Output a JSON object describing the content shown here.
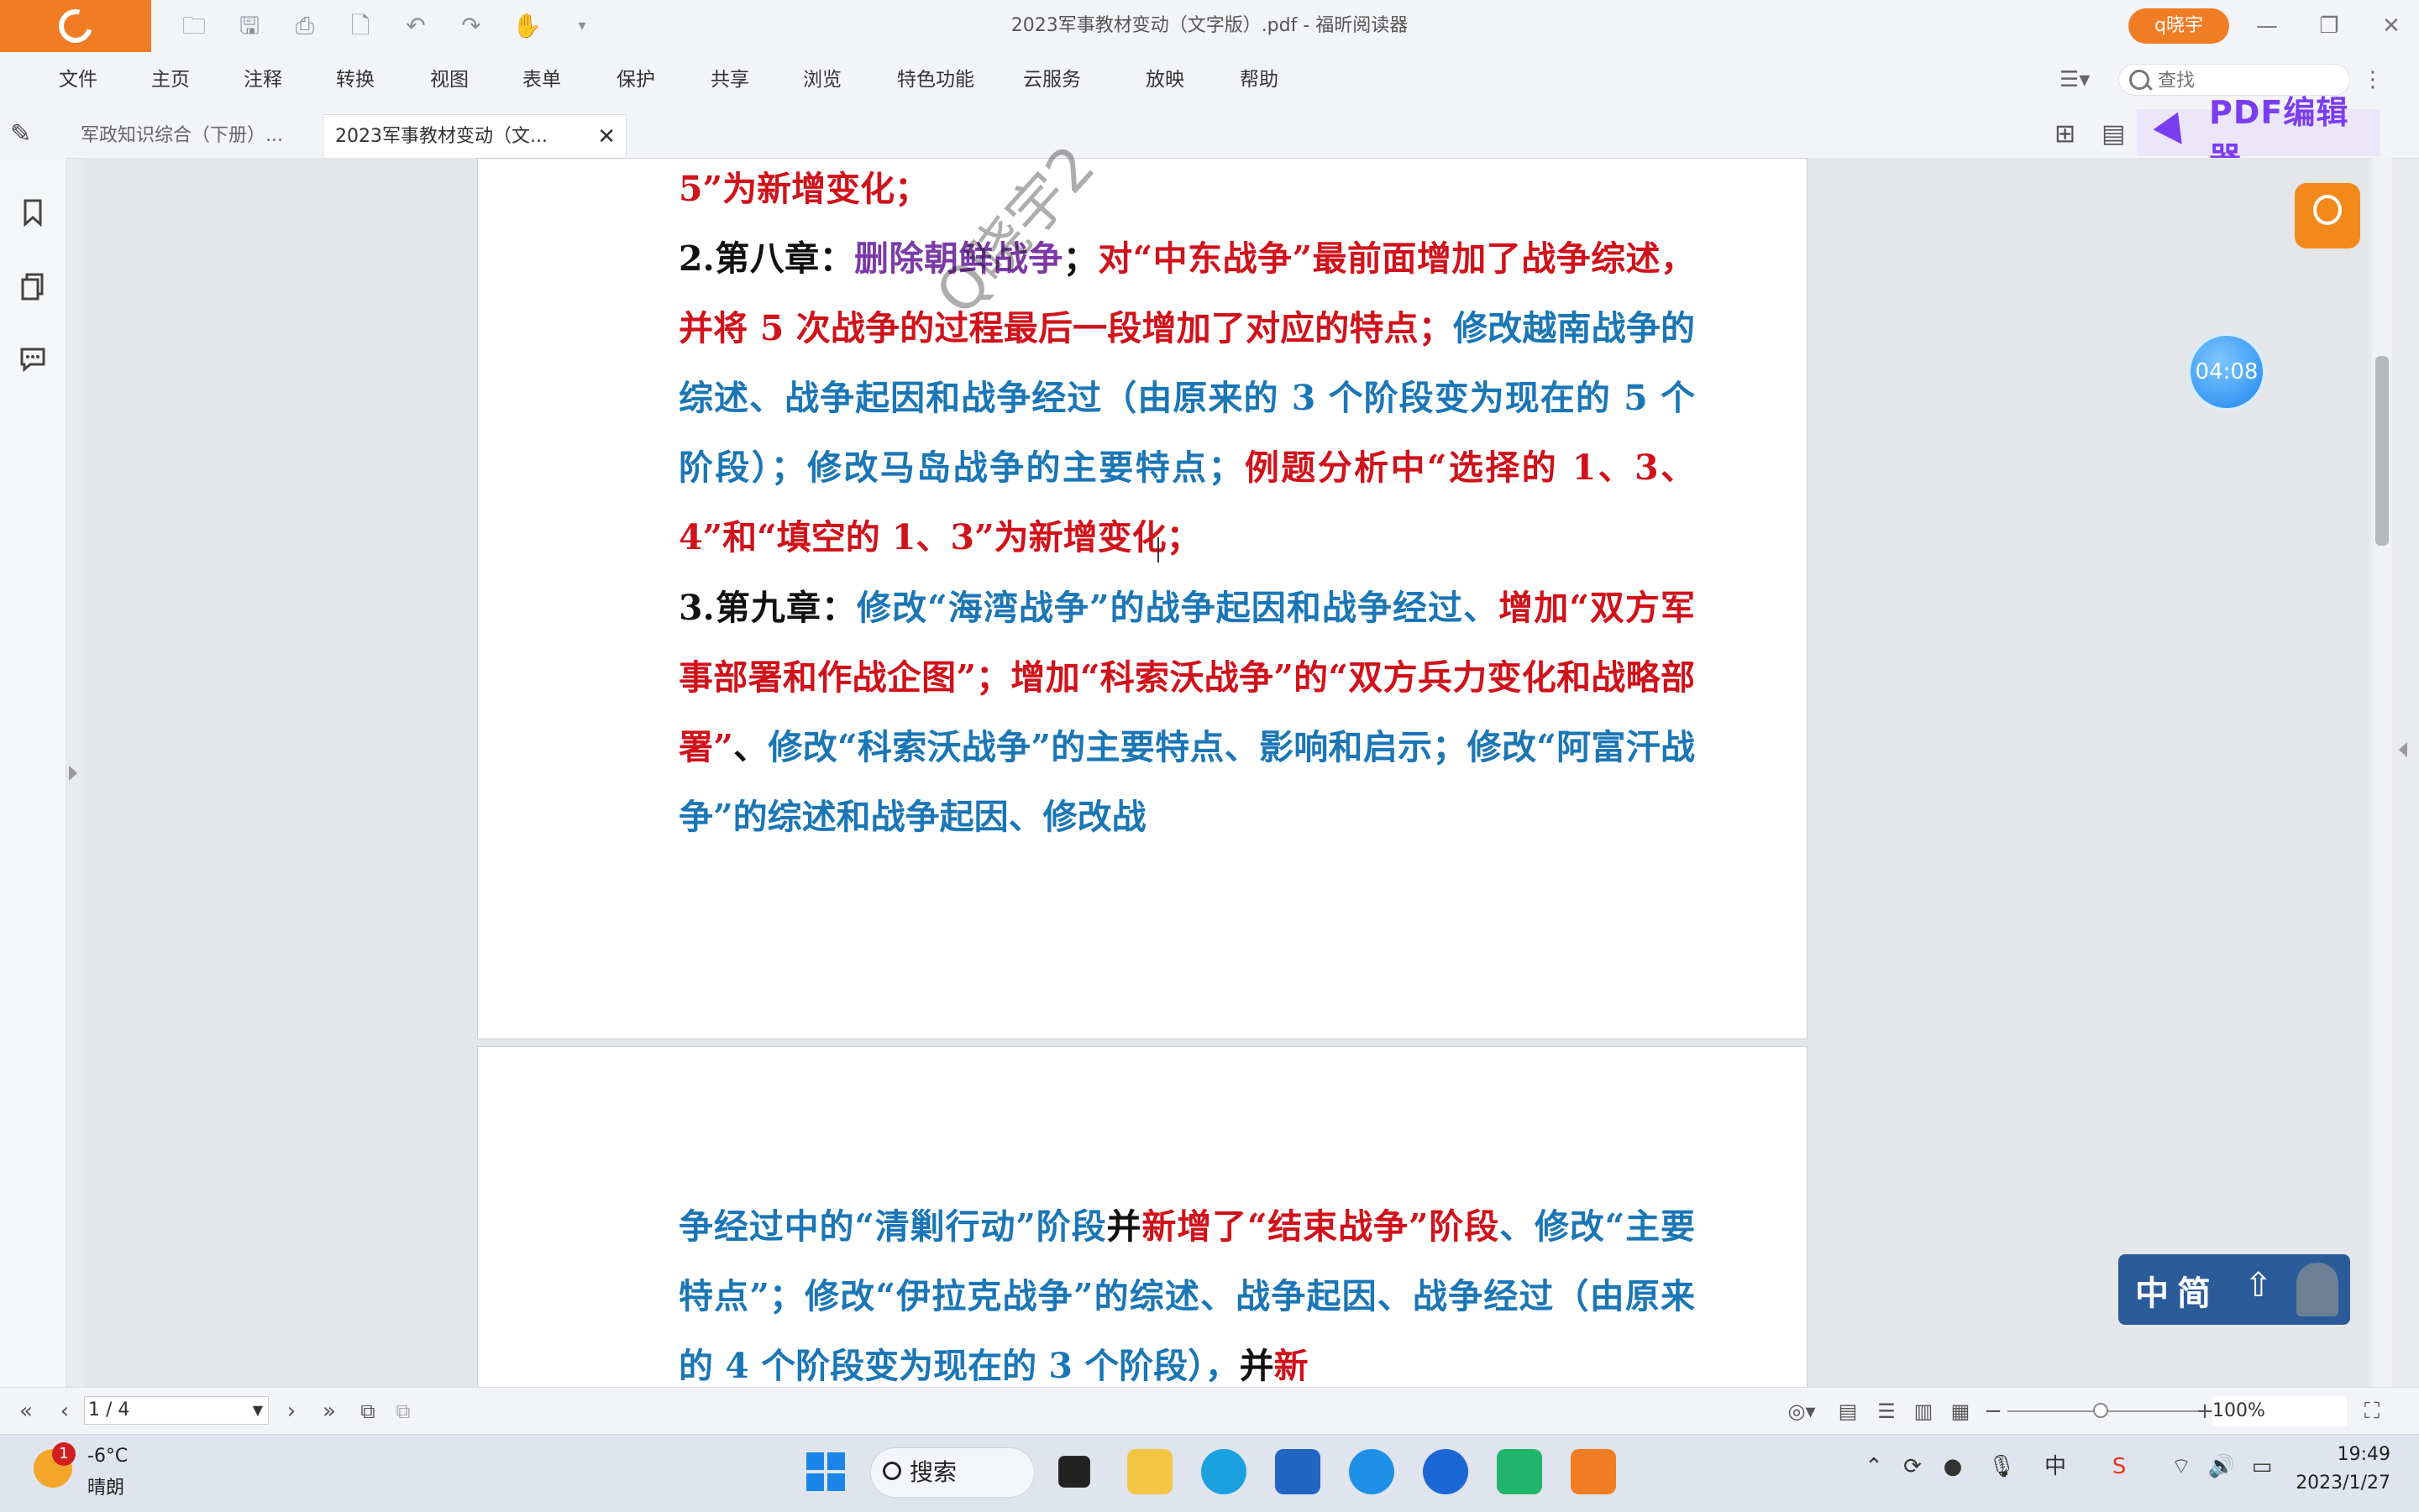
{
  "window": {
    "title": "2023军事教材变动（文字版）.pdf - 福昕阅读器",
    "user": "q晓宇",
    "min": "—",
    "restore": "❐",
    "close": "✕"
  },
  "menu": [
    "文件",
    "主页",
    "注释",
    "转换",
    "视图",
    "表单",
    "保护",
    "共享",
    "浏览",
    "特色功能",
    "云服务",
    "放映",
    "帮助"
  ],
  "search": {
    "placeholder": "查找"
  },
  "tabs": [
    {
      "label": "军政知识综合（下册）..."
    },
    {
      "label": "2023军事教材变动（文...",
      "close": "✕"
    }
  ],
  "pdf_editor": {
    "label": "PDF编辑器"
  },
  "document": {
    "page1": {
      "line0": {
        "a": "5”为新增变化；"
      },
      "ch8": {
        "prefix": "2.第八章：",
        "p1": "删除朝鲜战争",
        "p2": "；",
        "p3": "对“中东战争”最前面增加了战争综述，并将 5 次战争的过程最后一段增加了对应的特点；",
        "p4": "修改越南战争的综述、战争起因和战争经过（由原来的 3 个阶段变为现在的 5 个阶段）；修改马岛战争的主要特点；",
        "p5": "例题分析中“选择的 1、3、4”和“填空的 1、3”为新增变化；"
      },
      "ch9": {
        "prefix": "3.第九章：",
        "p1": "修改“海湾战争”的战争起因和战争经过、",
        "p2": "增加“双方军事部署和作战企图”；增加“科索沃战争”的“双方兵力变化和战略部署”",
        "p3": "、",
        "p4": "修改“科索沃战争”的主要特点、影响和启示；修改“阿富汗战争”的综述和战争起因、修改战"
      }
    },
    "page2": {
      "a": "争经过中的“清剿行动”阶段",
      "b": "并",
      "c": "新增了“结束战争”阶段",
      "d": "、修改“主要特点”；修改“伊拉克战争”的综述、战争起因、战争经过（由原来的 4 个阶段变为现在的 3 个阶段），",
      "e": "并",
      "f": "新"
    },
    "watermark": "Q晓宇2"
  },
  "timer": "04:08",
  "ime": {
    "label": "中简"
  },
  "status": {
    "page": "1 / 4",
    "zoom": "100%"
  },
  "taskbar": {
    "weather_badge": "1",
    "temp": "-6°C",
    "weather": "晴朗",
    "search": "搜索",
    "ime_lang": "中",
    "time": "19:49",
    "date": "2023/1/27"
  },
  "colors": {
    "accent": "#f07c24",
    "editor": "#7a3df0",
    "red_text": "#d0121b",
    "blue_text": "#1b76b5",
    "purple_text": "#7b3aa6"
  }
}
